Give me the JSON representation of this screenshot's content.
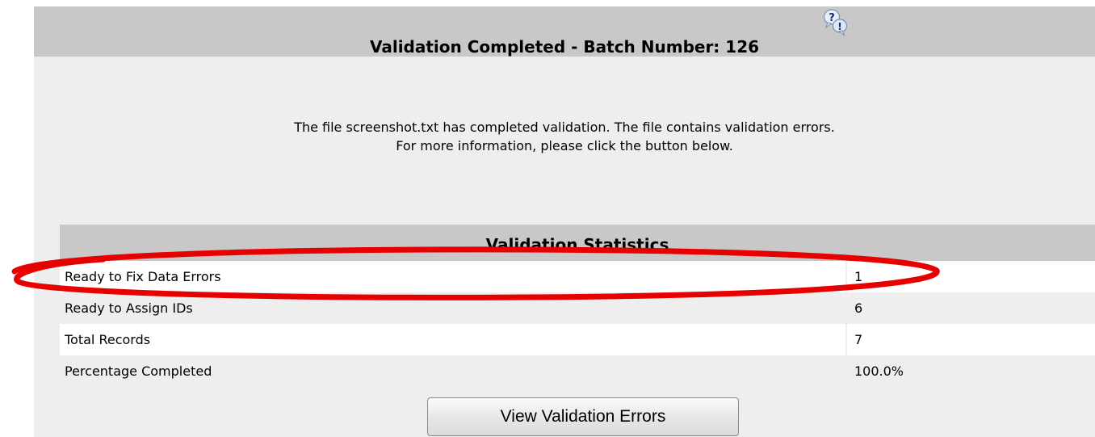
{
  "dialog": {
    "title": "Validation Completed - Batch Number: 126",
    "help_icon": "help-question-exclamation-icon",
    "message_line1": "The file screenshot.txt has completed validation. The file contains validation errors.",
    "message_line2": "For more information, please click the button below."
  },
  "stats": {
    "header": "Validation Statistics",
    "rows": [
      {
        "label": "Ready to Fix Data Errors",
        "value": "1"
      },
      {
        "label": "Ready to Assign IDs",
        "value": "6"
      },
      {
        "label": "Total Records",
        "value": "7"
      },
      {
        "label": "Percentage Completed",
        "value": "100.0%"
      }
    ]
  },
  "actions": {
    "view_errors_label": "View Validation Errors"
  },
  "colors": {
    "header_bg": "#c8c8c8",
    "panel_bg": "#eeeeee",
    "highlight": "#e60000"
  }
}
